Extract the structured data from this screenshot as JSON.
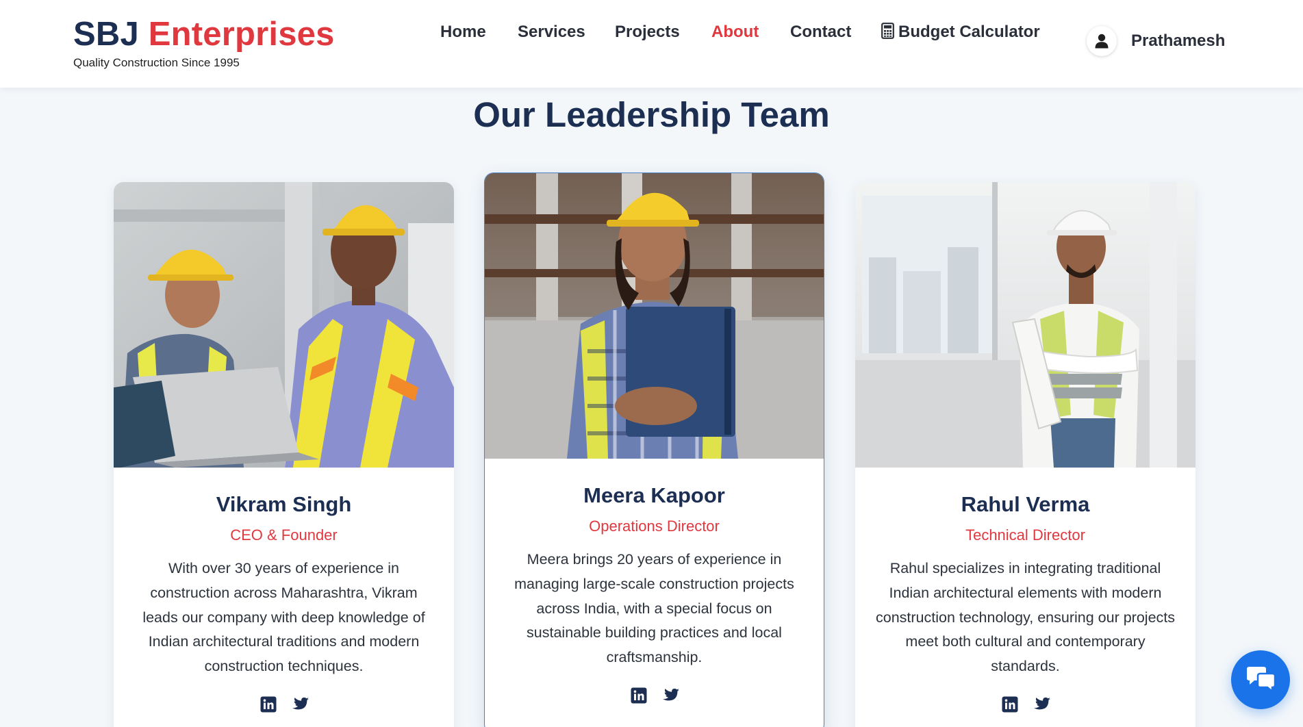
{
  "brand": {
    "name_part1": "SBJ",
    "name_part2": "Enterprises",
    "tagline": "Quality Construction Since 1995"
  },
  "nav": {
    "items": [
      "Home",
      "Services",
      "Projects",
      "About",
      "Contact",
      "Budget Calculator"
    ],
    "active": "About"
  },
  "user": {
    "name": "Prathamesh",
    "icon": "user-icon"
  },
  "section": {
    "title": "Our Leadership Team"
  },
  "team": [
    {
      "name": "Vikram Singh",
      "role": "CEO & Founder",
      "bio": "With over 30 years of experience in construction across Maharashtra, Vikram leads our company with deep knowledge of Indian architectural traditions and modern construction techniques.",
      "socials": [
        "linkedin-icon",
        "twitter-icon"
      ]
    },
    {
      "name": "Meera Kapoor",
      "role": "Operations Director",
      "bio": "Meera brings 20 years of experience in managing large-scale construction projects across India, with a special focus on sustainable building practices and local craftsmanship.",
      "socials": [
        "linkedin-icon",
        "twitter-icon"
      ]
    },
    {
      "name": "Rahul Verma",
      "role": "Technical Director",
      "bio": "Rahul specializes in integrating traditional Indian architectural elements with modern construction technology, ensuring our projects meet both cultural and contemporary standards.",
      "socials": [
        "linkedin-icon",
        "twitter-icon"
      ]
    }
  ],
  "colors": {
    "primary": "#1c2f52",
    "accent": "#e0383f",
    "chat": "#1a73e8",
    "background": "#f3f7fa"
  },
  "chat": {
    "icon": "chat-bubbles-icon"
  }
}
